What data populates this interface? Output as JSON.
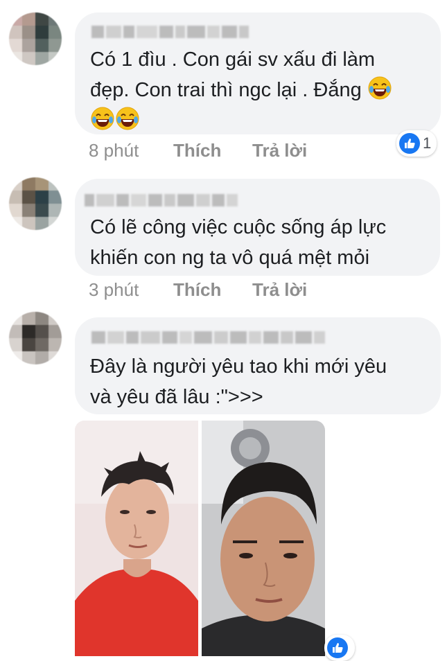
{
  "comments": [
    {
      "text_lines": [
        "Có 1 đìu . Con gái sv xấu đi làm",
        "đẹp. Con trai thì ngc lại . Đắng"
      ],
      "time": "8 phút",
      "like_label": "Thích",
      "reply_label": "Trả lời",
      "reaction_count": "1"
    },
    {
      "text_lines": [
        "Có lẽ công việc cuộc sống áp lực",
        "khiến con ng ta vô quá mệt mỏi"
      ],
      "time": "3 phút",
      "like_label": "Thích",
      "reply_label": "Trả lời"
    },
    {
      "text_lines": [
        "Đây là người yêu tao khi mới yêu",
        "và yêu đã lâu :\">>>"
      ],
      "reaction_count": ""
    }
  ],
  "icons": {
    "laugh_emoji": "face-with-tears-of-joy-icon",
    "like_reaction": "thumbs-up-icon"
  },
  "colors": {
    "bubble": "#f2f3f5",
    "like_blue": "#1877f2",
    "meta_gray": "#8e8e8e"
  }
}
